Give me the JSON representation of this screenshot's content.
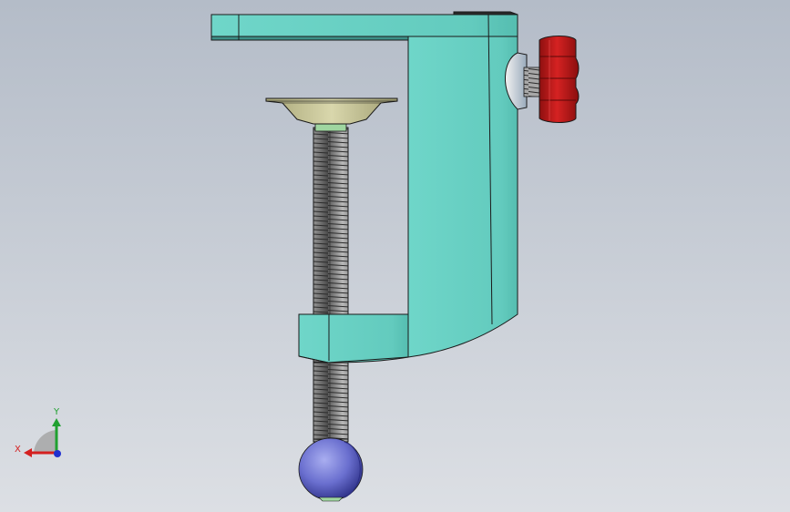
{
  "viewport": {
    "background_top": "#b4bcc8",
    "background_bottom": "#d9dde3"
  },
  "model": {
    "frame_color": "#67cfc2",
    "frame_shadow": "#4fb2a6",
    "screw_color": "#8c8c8c",
    "pad_color": "#c9c79a",
    "ball_color": "#6a6fcf",
    "knob_color": "#c11a1a",
    "edge_color": "#1a1a1a"
  },
  "triad": {
    "x_label": "X",
    "y_label": "Y",
    "x_color": "#d42020",
    "y_color": "#20a030",
    "z_color": "#2030d0"
  }
}
